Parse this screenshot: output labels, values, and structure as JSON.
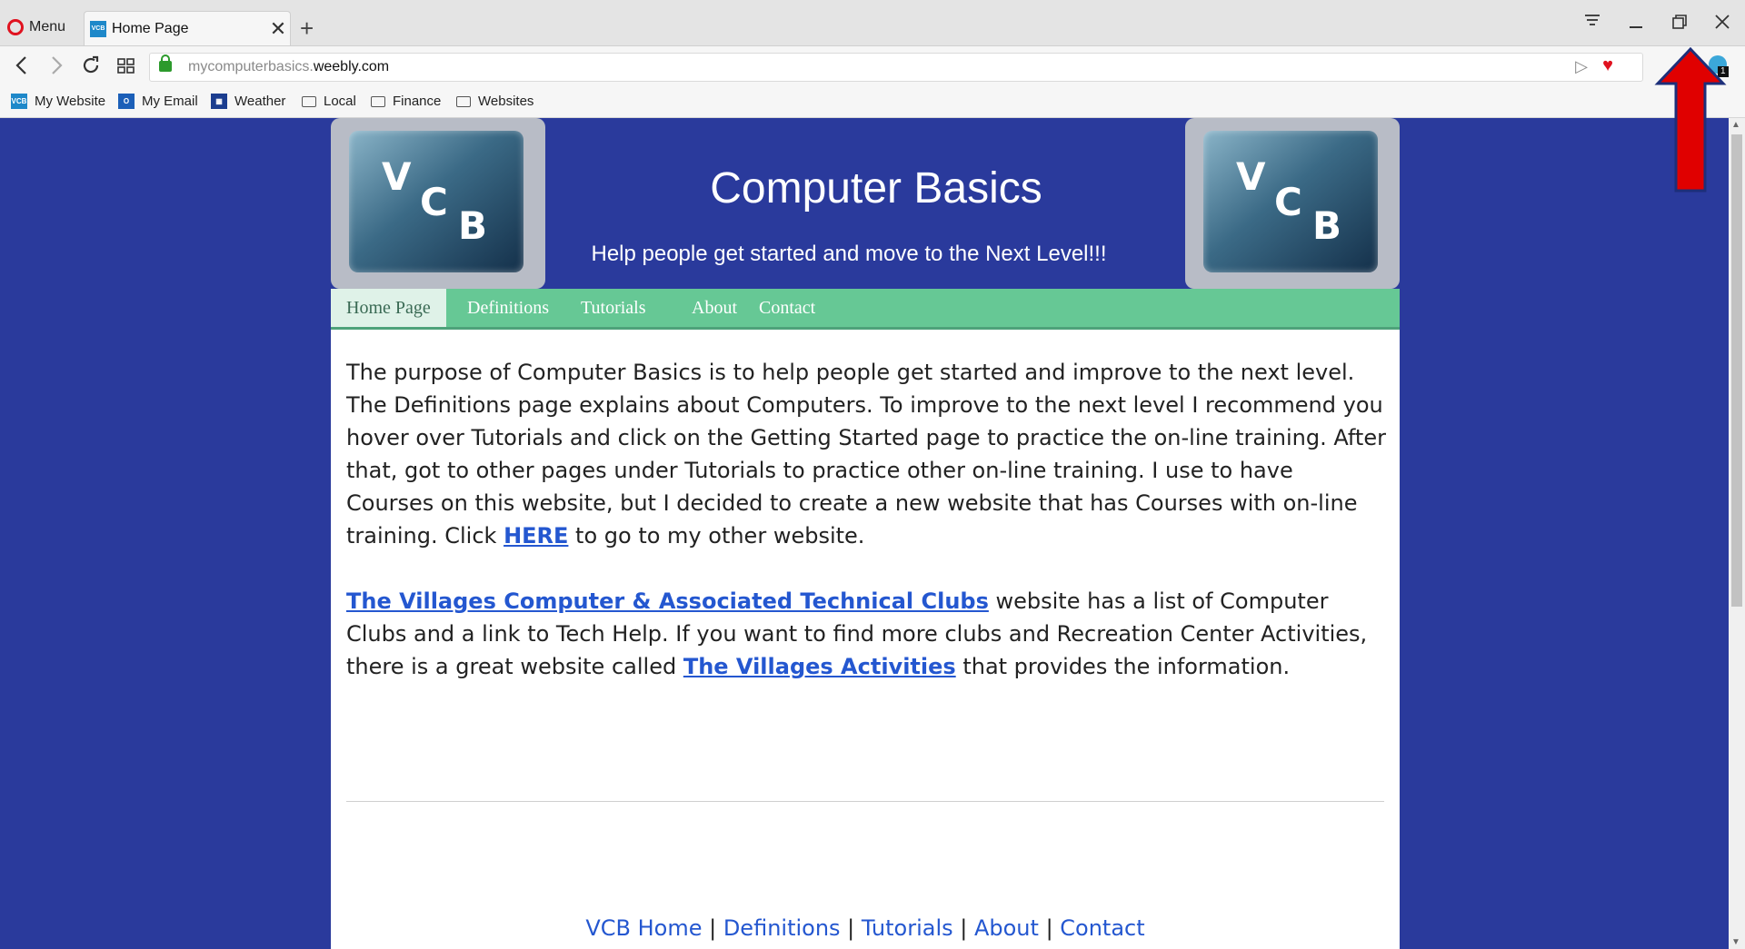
{
  "browser": {
    "menu_label": "Menu",
    "tab_title": "Home Page",
    "tab_favicon": "VCB",
    "tab_close": "✕",
    "new_tab": "+",
    "url_domain_prefix": "mycomputerbasics.",
    "url_domain": "weebly.com",
    "extension_badge": "1"
  },
  "bookmarks": [
    {
      "label": "My Website",
      "icon": "vcb-icon"
    },
    {
      "label": "My Email",
      "icon": "outlook-icon"
    },
    {
      "label": "Weather",
      "icon": "weather-icon"
    },
    {
      "label": "Local",
      "icon": "folder-icon"
    },
    {
      "label": "Finance",
      "icon": "folder-icon"
    },
    {
      "label": "Websites",
      "icon": "folder-icon"
    }
  ],
  "site": {
    "logo_letters": [
      "V",
      "C",
      "B"
    ],
    "title": "Computer Basics",
    "subtitle": "Help people get started and move to the Next Level!!!"
  },
  "nav": [
    "Home Page",
    "Definitions",
    "Tutorials",
    "About",
    "Contact"
  ],
  "content": {
    "p1_text": "The purpose of Computer Basics is to help people get started and improve to the next level. The Definitions page explains about Computers.  To improve to the next level I recommend you hover over Tutorials and click on the Getting Started page to practice the on-line training.  After that, got to other pages under Tutorials to practice other on-line training.  I use to have Courses on this website, but I decided to create a new website that has Courses with on-line training.  Click ",
    "p1_link": "HERE",
    "p1_tail": " to go to my other website.",
    "p2_link1": "The Villages Computer & Associated Technical Clubs",
    "p2_mid": " website has a list of Computer Clubs and a link to Tech Help.  If you want to find more clubs and Recreation Center Activities, there is a great website called ",
    "p2_link2": "The Villages Activities",
    "p2_tail": " that provides the information."
  },
  "footer": {
    "links": [
      "VCB Home",
      "Definitions",
      "Tutorials",
      "About",
      "Contact"
    ],
    "separator": " | "
  },
  "colors": {
    "page_bg": "#2a3a9c",
    "nav_bg": "#66c895",
    "link": "#2457d0",
    "annotation_arrow": "#e00000"
  }
}
